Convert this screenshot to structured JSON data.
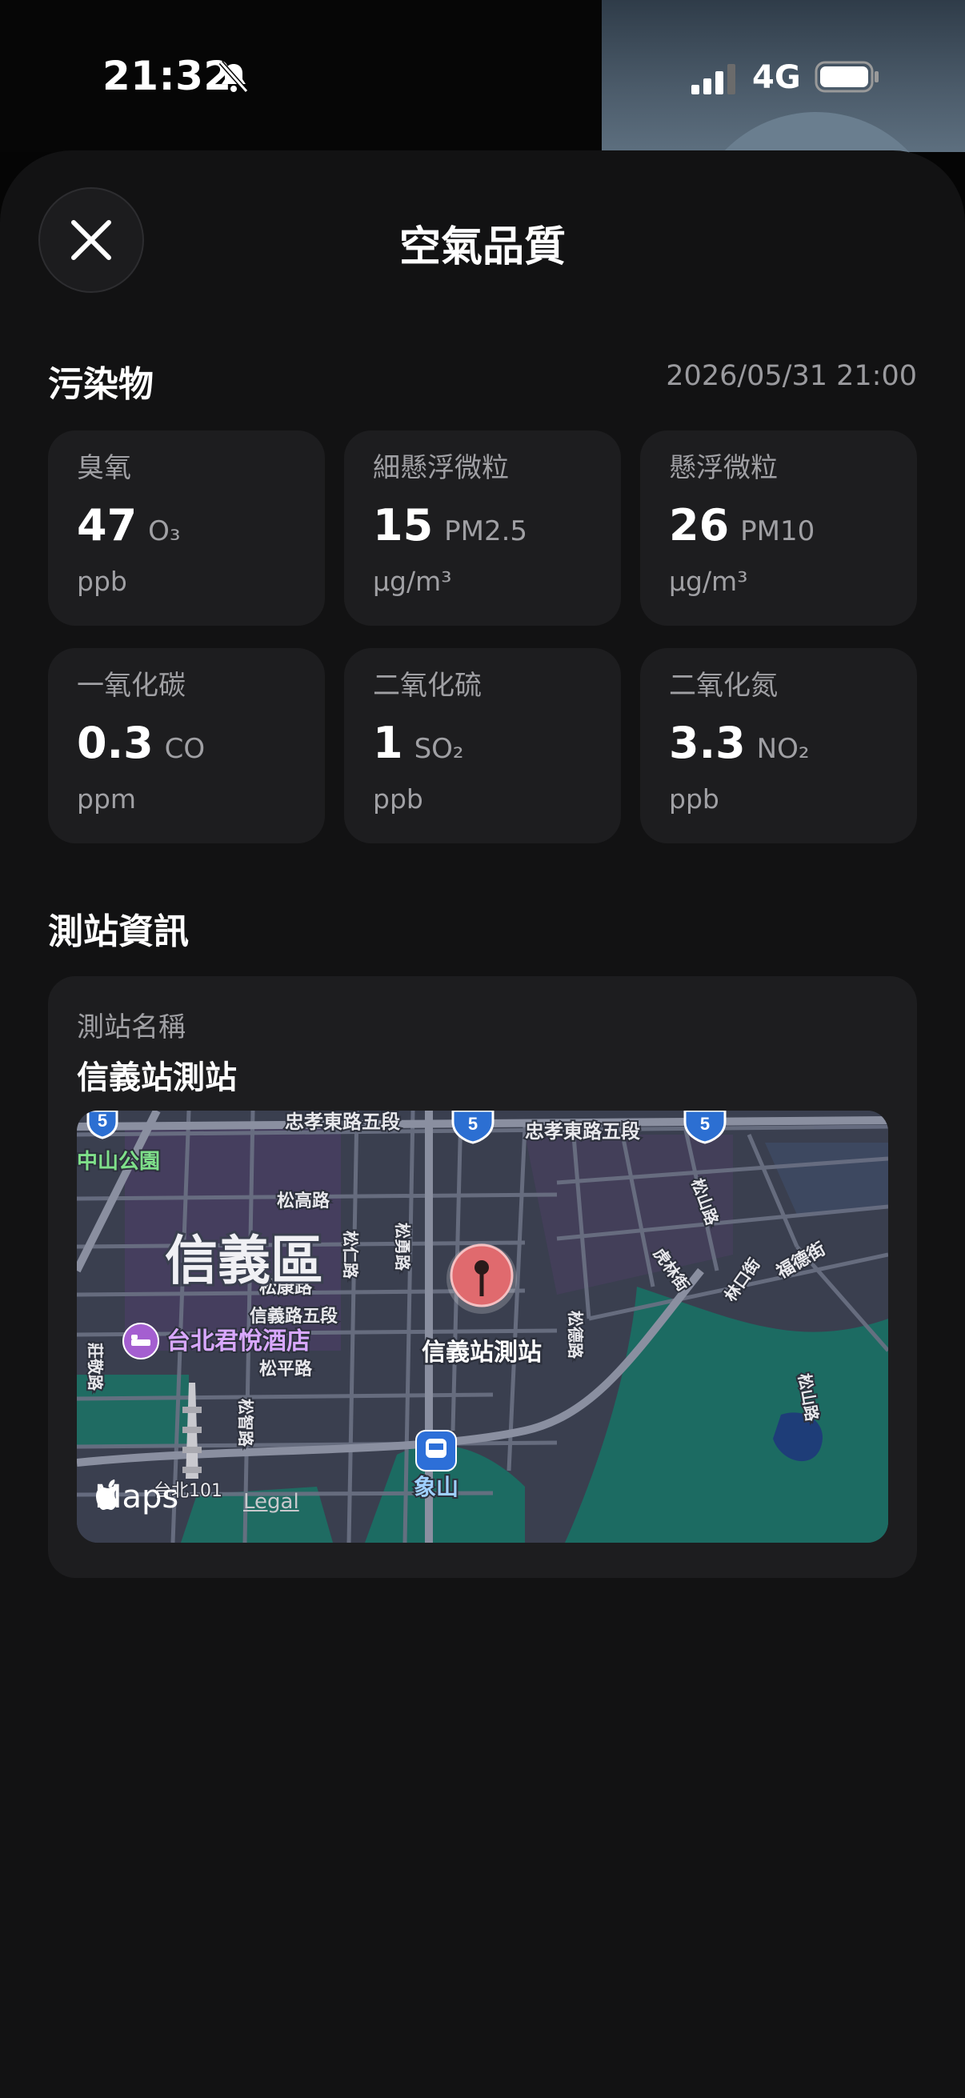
{
  "status": {
    "time": "21:32",
    "network": "4G"
  },
  "header": {
    "title": "空氣品質",
    "close_icon": "close-icon"
  },
  "pollutants": {
    "section_title": "污染物",
    "timestamp": "2026/05/31 21:00",
    "items": [
      {
        "label": "臭氧",
        "value": "47",
        "formula": "O₃",
        "unit": "ppb"
      },
      {
        "label": "細懸浮微粒",
        "value": "15",
        "formula": "PM2.5",
        "unit": "µg/m³"
      },
      {
        "label": "懸浮微粒",
        "value": "26",
        "formula": "PM10",
        "unit": "µg/m³"
      },
      {
        "label": "一氧化碳",
        "value": "0.3",
        "formula": "CO",
        "unit": "ppm"
      },
      {
        "label": "二氧化硫",
        "value": "1",
        "formula": "SO₂",
        "unit": "ppb"
      },
      {
        "label": "二氧化氮",
        "value": "3.3",
        "formula": "NO₂",
        "unit": "ppb"
      }
    ]
  },
  "station": {
    "section_title": "測站資訊",
    "name_label": "測站名稱",
    "name": "信義站測站",
    "map": {
      "district": "信義區",
      "pin_label": "信義站測站",
      "hotel": "台北君悅酒店",
      "metro": "象山",
      "landmark": "台北101",
      "park": "中山公園",
      "roads": [
        "忠孝東路五段",
        "忠孝東路五段",
        "松高路",
        "松仁路",
        "松勇路",
        "松德路",
        "松山路",
        "虎林街",
        "林口街",
        "福德街",
        "松康路",
        "信義路五段",
        "松平路",
        "松智路",
        "莊敬路",
        "松山路"
      ],
      "highway_shield": "5",
      "brand": "Maps",
      "legal": "Legal"
    }
  },
  "colors": {
    "sheet": "#121213",
    "card": "#1d1d1f",
    "pin": "#e06a6e",
    "accent_green": "#1c6b62"
  }
}
